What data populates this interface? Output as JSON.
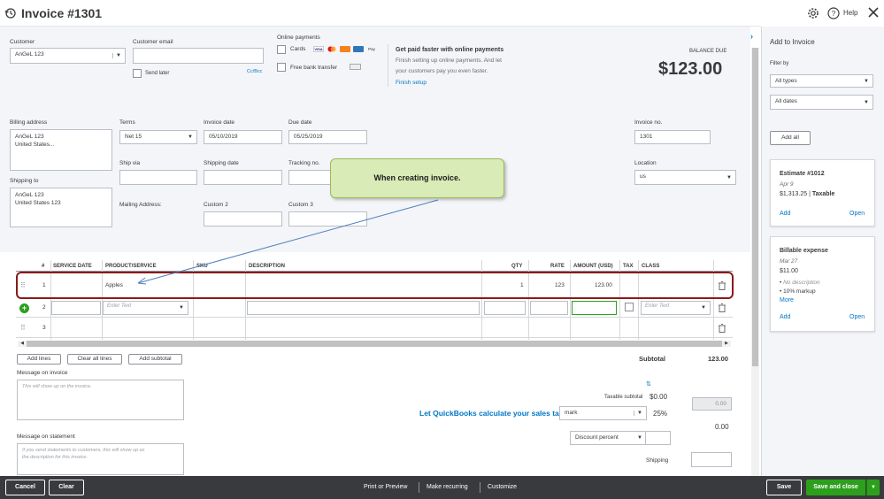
{
  "header": {
    "title": "Invoice #1301",
    "help": "Help"
  },
  "customer": {
    "label": "Customer",
    "value": "AnGeL 123",
    "email_label": "Customer email",
    "email_value": "",
    "send_later": "Send later",
    "cc_bcc": "Cc/Bcc"
  },
  "online_payments": {
    "label": "Online payments",
    "cards": "Cards",
    "bank": "Free bank transfer"
  },
  "promo": {
    "title": "Get paid faster with online payments",
    "body1": "Finish setting up online payments. And let",
    "body2": "your customers pay you even faster.",
    "link": "Finish setup"
  },
  "balance": {
    "label": "BALANCE DUE",
    "amount": "$123.00"
  },
  "billing": {
    "label": "Billing address",
    "lines": [
      "AnGeL 123",
      "United States..."
    ]
  },
  "shipping_to": {
    "label": "Shipping to",
    "lines": [
      "AnGeL 123",
      "United States 123"
    ]
  },
  "terms": {
    "label": "Terms",
    "value": "Net 15"
  },
  "invoice_date": {
    "label": "Invoice date",
    "value": "05/10/2019"
  },
  "due_date": {
    "label": "Due date",
    "value": "05/25/2019"
  },
  "invoice_no": {
    "label": "Invoice no.",
    "value": "1301"
  },
  "ship_via": {
    "label": "Ship via"
  },
  "shipping_date": {
    "label": "Shipping date"
  },
  "tracking_no": {
    "label": "Tracking no."
  },
  "location": {
    "label": "Location",
    "value": "us"
  },
  "mailing_address": {
    "label": "Mailing Address:"
  },
  "custom2": {
    "label": "Custom 2"
  },
  "custom3": {
    "label": "Custom 3"
  },
  "callout": {
    "text": "When creating invoice."
  },
  "table": {
    "headers": {
      "num": "#",
      "service_date": "SERVICE DATE",
      "product": "PRODUCT/SERVICE",
      "sku": "SKU",
      "description": "DESCRIPTION",
      "qty": "QTY",
      "rate": "RATE",
      "amount": "AMOUNT (USD)",
      "tax": "TAX",
      "class": "CLASS"
    },
    "row1": {
      "num": "1",
      "product": "Apples",
      "qty": "1",
      "rate": "123",
      "amount": "123.00"
    },
    "row2": {
      "num": "2",
      "product_ph": "Enter Text",
      "class_ph": "Enter Text"
    },
    "row3": {
      "num": "3"
    }
  },
  "actions": {
    "add_lines": "Add lines",
    "clear_all": "Clear all lines",
    "add_subtotal": "Add subtotal"
  },
  "totals": {
    "subtotal_label": "Subtotal",
    "subtotal_value": "123.00",
    "taxable_label": "Taxable subtotal",
    "taxable_value": "$0.00",
    "tax_link": "Let QuickBooks calculate your sales tax",
    "tax_select": "mark",
    "tax_rate": "25%",
    "tax_value": "0.00",
    "tax_total": "0.00",
    "discount_select": "Discount percent",
    "shipping_label": "Shipping"
  },
  "message_invoice": {
    "label": "Message on invoice",
    "placeholder": "This will show up on the invoice."
  },
  "message_statement": {
    "label": "Message on statement",
    "placeholder1": "If you send statements to customers, this will show up as",
    "placeholder2": "the description for this invoice."
  },
  "panel": {
    "title": "Add to Invoice",
    "filter_label": "Filter by",
    "filter_type": "All types",
    "filter_date": "All dates",
    "add_all": "Add all",
    "card1": {
      "title": "Estimate #1012",
      "date": "Apr 9",
      "amount": "$1,313.25",
      "taxable": "Taxable",
      "add": "Add",
      "open": "Open"
    },
    "card2": {
      "title": "Billable expense",
      "date": "Mar 27",
      "amount": "$11.00",
      "bullet1": "No description",
      "bullet2": "10% markup",
      "more": "More",
      "add": "Add",
      "open": "Open"
    }
  },
  "footer": {
    "cancel": "Cancel",
    "clear": "Clear",
    "print": "Print or Preview",
    "recurring": "Make recurring",
    "customize": "Customize",
    "save": "Save",
    "save_close": "Save and close"
  },
  "colors": {
    "brand_green": "#2ca01c",
    "link_blue": "#0077c5",
    "footer_bg": "#393a3d",
    "callout_bg": "#d9ebb6",
    "highlight_red": "#8b1a1a"
  }
}
